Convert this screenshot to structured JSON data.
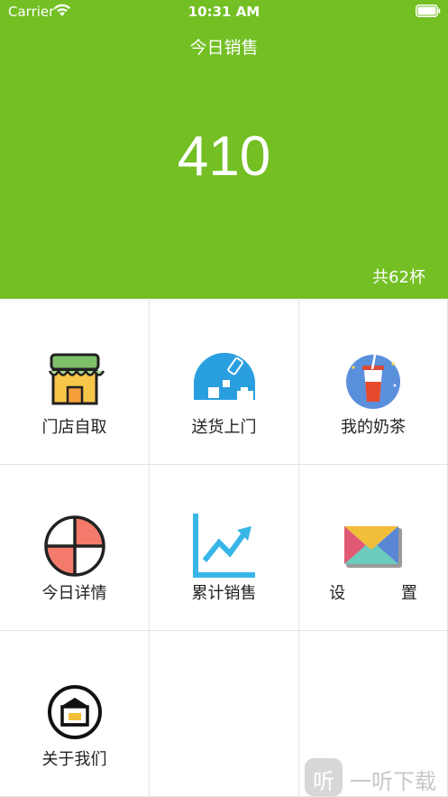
{
  "status_bar": {
    "carrier": "Carrier",
    "time": "10:31 AM"
  },
  "header": {
    "title": "今日销售",
    "total_sales": "410",
    "cup_count": "共62杯",
    "background_color": "#73bf24"
  },
  "menu": [
    {
      "label": "门店自取",
      "icon": "storefront-icon"
    },
    {
      "label": "送货上门",
      "icon": "delivery-icon"
    },
    {
      "label": "我的奶茶",
      "icon": "milk-tea-cup-icon"
    },
    {
      "label": "今日详情",
      "icon": "pie-chart-icon"
    },
    {
      "label": "累计销售",
      "icon": "trend-chart-icon"
    },
    {
      "label": "设 置",
      "icon": "settings-envelope-icon"
    },
    {
      "label": "关于我们",
      "icon": "shop-badge-icon"
    }
  ],
  "watermark": {
    "logo": "听",
    "text": "一听下载"
  }
}
